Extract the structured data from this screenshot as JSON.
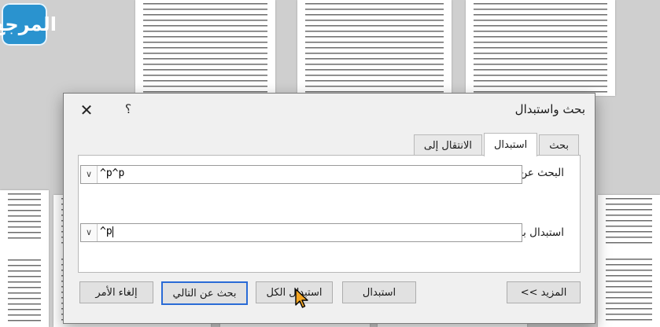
{
  "logo": {
    "text": "المرجع"
  },
  "dialog": {
    "title": "بحث واستبدال",
    "help_label": "؟",
    "close_label": "✕",
    "tabs": [
      {
        "label": "بحث",
        "active": false
      },
      {
        "label": "استبدال",
        "active": true
      },
      {
        "label": "الانتقال إلى",
        "active": false
      }
    ],
    "find": {
      "label": "البحث عن:",
      "value": "^p^p"
    },
    "replace": {
      "label": "استبدال بـ:",
      "value": "^p"
    },
    "buttons": {
      "more": "المزيد >>",
      "replace": "استبدال",
      "replace_all": "استبدال الكل",
      "find_next": "بحث عن التالي",
      "cancel": "إلغاء الأمر"
    }
  },
  "colors": {
    "dialog_bg": "#f0f0f0",
    "accent": "#2a6bd6",
    "logo": "#2a93cf"
  }
}
